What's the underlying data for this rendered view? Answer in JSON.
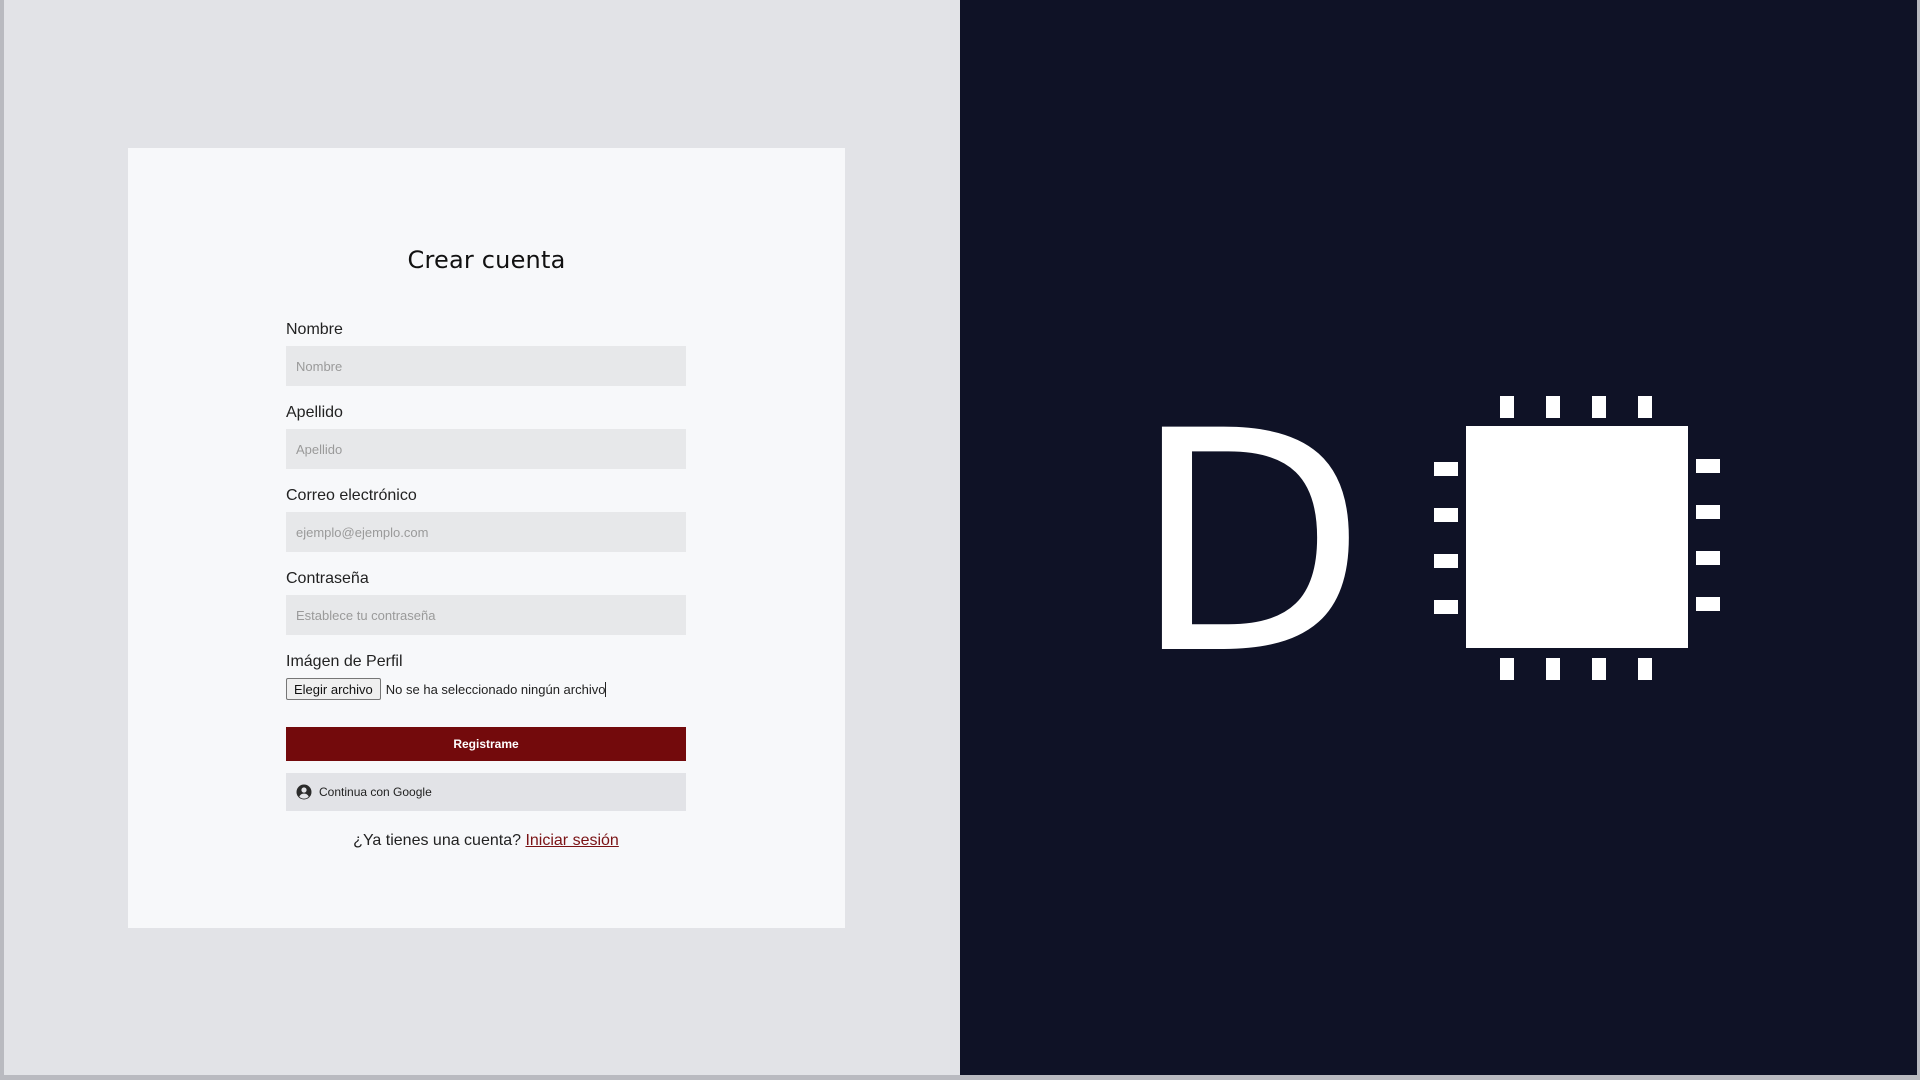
{
  "form": {
    "title": "Crear cuenta",
    "fields": [
      {
        "label": "Nombre",
        "placeholder": "Nombre",
        "value": ""
      },
      {
        "label": "Apellido",
        "placeholder": "Apellido",
        "value": ""
      },
      {
        "label": "Correo electrónico",
        "placeholder": "ejemplo@ejemplo.com",
        "value": ""
      },
      {
        "label": "Contraseña",
        "placeholder": "Establece tu contraseña",
        "value": ""
      }
    ],
    "file": {
      "label": "Imágen de Perfil",
      "button_label": "Elegir archivo",
      "status": "No se ha seleccionado ningún archivo"
    },
    "submit_label": "Registrame",
    "google_label": "Continua con Google",
    "signin_prompt": "¿Ya tienes una cuenta?",
    "signin_link": "Iniciar sesión"
  },
  "logo": {
    "letter": "D",
    "icon": "chip-icon"
  },
  "colors": {
    "left_background": "#e2e3e7",
    "card_background": "#f7f8fa",
    "right_background": "#0f1226",
    "primary_button": "#730a0c",
    "link": "#7a1214",
    "logo": "#ffffff"
  }
}
